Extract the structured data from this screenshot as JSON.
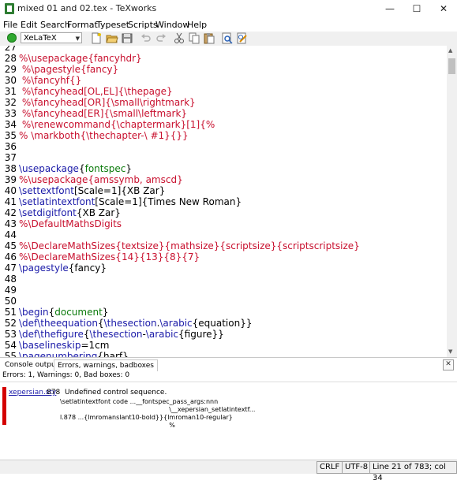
{
  "window": {
    "title": "mixed 01 and 02.tex - TeXworks",
    "minimize": "—",
    "maximize": "☐",
    "close": "✕"
  },
  "menu": [
    "File",
    "Edit",
    "Search",
    "Format",
    "Typeset",
    "Scripts",
    "Window",
    "Help"
  ],
  "toolbar": {
    "engine": "XeLaTeX",
    "icons": [
      "new-document-icon",
      "open-folder-icon",
      "save-icon",
      "undo-icon",
      "redo-icon",
      "cut-icon",
      "copy-icon",
      "paste-icon",
      "find-icon",
      "replace-icon"
    ]
  },
  "editor": {
    "lines": [
      {
        "n": "27",
        "segs": []
      },
      {
        "n": "28",
        "segs": [
          [
            "%\\usepackage{fancyhdr}",
            "red"
          ]
        ]
      },
      {
        "n": "29",
        "segs": [
          [
            " %\\pagestyle{fancy}",
            "red"
          ]
        ]
      },
      {
        "n": "30",
        "segs": [
          [
            " %\\fancyhf{}",
            "red"
          ]
        ]
      },
      {
        "n": "31",
        "segs": [
          [
            " %\\fancyhead[OL,EL]{\\thepage}",
            "red"
          ]
        ]
      },
      {
        "n": "32",
        "segs": [
          [
            " %\\fancyhead[OR]{\\small\\rightmark}",
            "red"
          ]
        ]
      },
      {
        "n": "33",
        "segs": [
          [
            " %\\fancyhead[ER]{\\small\\leftmark}",
            "red"
          ]
        ]
      },
      {
        "n": "34",
        "segs": [
          [
            " %\\renewcommand{\\chaptermark}[1]{%",
            "red"
          ]
        ]
      },
      {
        "n": "35",
        "segs": [
          [
            "% \\markboth{\\thechapter-\\ #1}{}}",
            "red"
          ]
        ]
      },
      {
        "n": "36",
        "segs": []
      },
      {
        "n": "37",
        "segs": []
      },
      {
        "n": "38",
        "segs": [
          [
            "\\usepackage",
            "blue"
          ],
          [
            "{",
            "black"
          ],
          [
            "fontspec",
            "green"
          ],
          [
            "}",
            "black"
          ]
        ]
      },
      {
        "n": "39",
        "segs": [
          [
            "%\\usepackage{amssymb, amscd}",
            "red"
          ]
        ]
      },
      {
        "n": "40",
        "segs": [
          [
            "\\settextfont",
            "blue"
          ],
          [
            "[Scale=1]{XB Zar}",
            "black"
          ]
        ]
      },
      {
        "n": "41",
        "segs": [
          [
            "\\setlatintextfont",
            "blue"
          ],
          [
            "[Scale=1]{Times New Roman}",
            "black"
          ]
        ]
      },
      {
        "n": "42",
        "segs": [
          [
            "\\setdigitfont",
            "blue"
          ],
          [
            "{XB Zar}",
            "black"
          ]
        ]
      },
      {
        "n": "43",
        "segs": [
          [
            "%\\DefaultMathsDigits",
            "red"
          ]
        ]
      },
      {
        "n": "44",
        "segs": []
      },
      {
        "n": "45",
        "segs": [
          [
            "%\\DeclareMathSizes{textsize}{mathsize}{scriptsize}{scriptscriptsize}",
            "red"
          ]
        ]
      },
      {
        "n": "46",
        "segs": [
          [
            "%\\DeclareMathSizes{14}{13}{8}{7}",
            "red"
          ]
        ]
      },
      {
        "n": "47",
        "segs": [
          [
            "\\pagestyle",
            "blue"
          ],
          [
            "{fancy}",
            "black"
          ]
        ]
      },
      {
        "n": "48",
        "segs": []
      },
      {
        "n": "49",
        "segs": []
      },
      {
        "n": "50",
        "segs": []
      },
      {
        "n": "51",
        "segs": [
          [
            "\\begin",
            "blue"
          ],
          [
            "{",
            "black"
          ],
          [
            "document",
            "green"
          ],
          [
            "}",
            "black"
          ]
        ]
      },
      {
        "n": "52",
        "segs": [
          [
            "\\def\\theequation",
            "blue"
          ],
          [
            "{",
            "black"
          ],
          [
            "\\thesection",
            "blue"
          ],
          [
            ".",
            "black"
          ],
          [
            "\\arabic",
            "blue"
          ],
          [
            "{equation}}",
            "black"
          ]
        ]
      },
      {
        "n": "53",
        "segs": [
          [
            "\\def\\thefigure",
            "blue"
          ],
          [
            "{",
            "black"
          ],
          [
            "\\thesection",
            "blue"
          ],
          [
            "-",
            "black"
          ],
          [
            "\\arabic",
            "blue"
          ],
          [
            "{figure}}",
            "black"
          ]
        ]
      },
      {
        "n": "54",
        "segs": [
          [
            "\\baselineskip",
            "blue"
          ],
          [
            "=1cm",
            "black"
          ]
        ]
      },
      {
        "n": "55",
        "segs": [
          [
            "\\pagenumbering",
            "blue"
          ],
          [
            "{harf}",
            "black"
          ]
        ]
      }
    ]
  },
  "panel": {
    "tabs": [
      "Console output",
      "Errors, warnings, badboxes"
    ],
    "close": "✕",
    "summary": "Errors: 1, Warnings: 0, Bad boxes: 0",
    "error": {
      "file": "xepersian.sty",
      "line": "878",
      "message": "Undefined control sequence.",
      "details": [
        "\\setlatintextfont code ...__fontspec_pass_args:nnn",
        "                                                    \\__xepersian_setlatintextf...",
        "l.878 ...{lmromanslant10-bold}}{lmroman10-regular}",
        "                                                    %"
      ]
    }
  },
  "status": {
    "eol": "CRLF",
    "encoding": "UTF-8",
    "position": "Line 21 of 783; col 34"
  },
  "colors": {
    "red": "#c8102e",
    "blue": "#1a1aa8",
    "green": "#0a7a0a",
    "error": "#d40000"
  }
}
